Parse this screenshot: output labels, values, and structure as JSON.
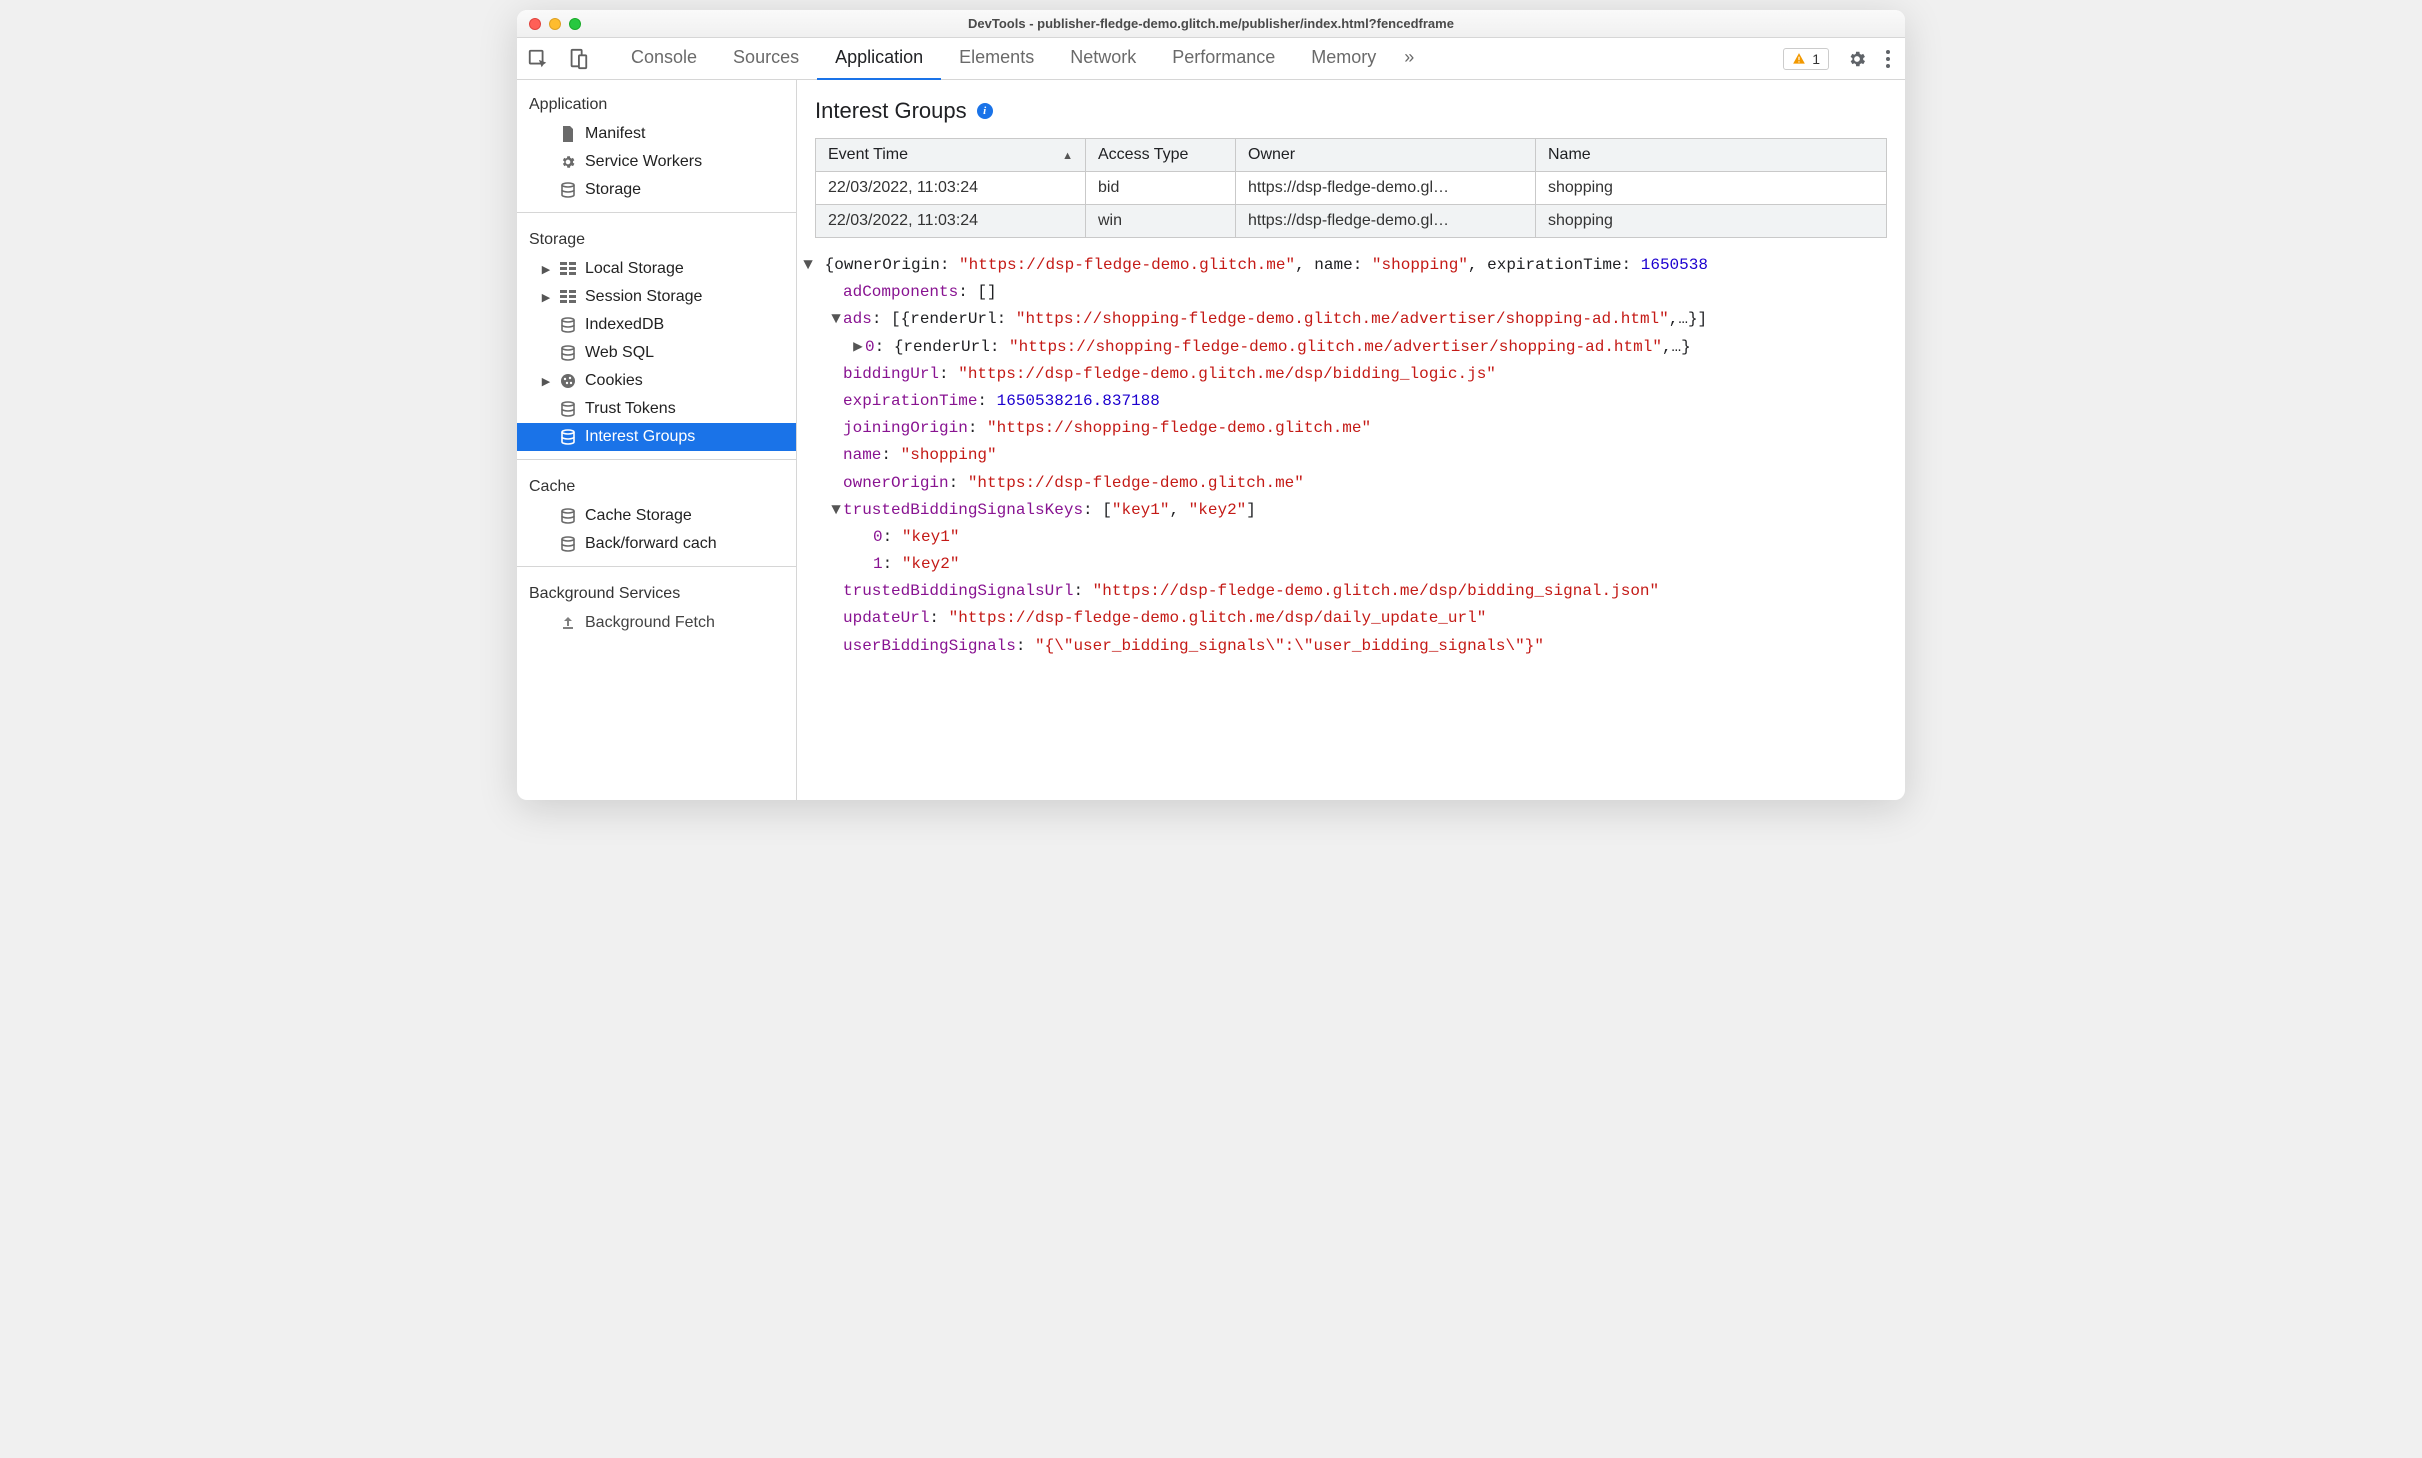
{
  "window": {
    "title": "DevTools - publisher-fledge-demo.glitch.me/publisher/index.html?fencedframe"
  },
  "toolbar": {
    "tabs": [
      "Console",
      "Sources",
      "Application",
      "Elements",
      "Network",
      "Performance",
      "Memory"
    ],
    "active_tab": "Application",
    "overflow_glyph": "»",
    "warning_count": "1"
  },
  "sidebar": {
    "groups": [
      {
        "title": "Application",
        "items": [
          {
            "label": "Manifest",
            "icon": "file-icon",
            "caret": "none"
          },
          {
            "label": "Service Workers",
            "icon": "gear-icon",
            "caret": "none"
          },
          {
            "label": "Storage",
            "icon": "db-icon",
            "caret": "none"
          }
        ]
      },
      {
        "title": "Storage",
        "items": [
          {
            "label": "Local Storage",
            "icon": "grid-icon",
            "caret": "closed"
          },
          {
            "label": "Session Storage",
            "icon": "grid-icon",
            "caret": "closed"
          },
          {
            "label": "IndexedDB",
            "icon": "db-icon",
            "caret": "none"
          },
          {
            "label": "Web SQL",
            "icon": "db-icon",
            "caret": "none"
          },
          {
            "label": "Cookies",
            "icon": "cookie-icon",
            "caret": "closed"
          },
          {
            "label": "Trust Tokens",
            "icon": "db-icon",
            "caret": "none"
          },
          {
            "label": "Interest Groups",
            "icon": "db-icon",
            "caret": "none",
            "active": true
          }
        ]
      },
      {
        "title": "Cache",
        "items": [
          {
            "label": "Cache Storage",
            "icon": "db-icon",
            "caret": "none"
          },
          {
            "label": "Back/forward cach",
            "icon": "db-icon",
            "caret": "none"
          }
        ]
      },
      {
        "title": "Background Services",
        "items": [
          {
            "label": "Background Fetch",
            "icon": "upload-icon",
            "caret": "none"
          }
        ]
      }
    ]
  },
  "panel": {
    "title": "Interest Groups",
    "table": {
      "columns": [
        "Event Time",
        "Access Type",
        "Owner",
        "Name"
      ],
      "sort_column": 0,
      "rows": [
        {
          "time": "22/03/2022, 11:03:24",
          "type": "bid",
          "owner": "https://dsp-fledge-demo.gl…",
          "name": "shopping"
        },
        {
          "time": "22/03/2022, 11:03:24",
          "type": "win",
          "owner": "https://dsp-fledge-demo.gl…",
          "name": "shopping"
        }
      ]
    },
    "detail": {
      "header_prefix": "{ownerOrigin: ",
      "header_owner": "\"https://dsp-fledge-demo.glitch.me\"",
      "header_mid1": ", name: ",
      "header_name": "\"shopping\"",
      "header_mid2": ", expirationTime: ",
      "header_exp": "1650538",
      "adComponents_key": "adComponents",
      "adComponents_val": "[]",
      "ads_key": "ads",
      "ads_summary_pre": "[{renderUrl: ",
      "ads_summary_url": "\"https://shopping-fledge-demo.glitch.me/advertiser/shopping-ad.html\"",
      "ads_summary_post": ",…}]",
      "ads0_key": "0",
      "ads0_pre": "{renderUrl: ",
      "ads0_url": "\"https://shopping-fledge-demo.glitch.me/advertiser/shopping-ad.html\"",
      "ads0_post": ",…}",
      "biddingUrl_key": "biddingUrl",
      "biddingUrl_val": "\"https://dsp-fledge-demo.glitch.me/dsp/bidding_logic.js\"",
      "expirationTime_key": "expirationTime",
      "expirationTime_val": "1650538216.837188",
      "joiningOrigin_key": "joiningOrigin",
      "joiningOrigin_val": "\"https://shopping-fledge-demo.glitch.me\"",
      "name_key": "name",
      "name_val": "\"shopping\"",
      "ownerOrigin_key": "ownerOrigin",
      "ownerOrigin_val": "\"https://dsp-fledge-demo.glitch.me\"",
      "tbsKeys_key": "trustedBiddingSignalsKeys",
      "tbsKeys_val_pre": "[",
      "tbsKeys_val_items0": "\"key1\"",
      "tbsKeys_val_sep": ", ",
      "tbsKeys_val_items1": "\"key2\"",
      "tbsKeys_val_post": "]",
      "tbs0_key": "0",
      "tbs0_val": "\"key1\"",
      "tbs1_key": "1",
      "tbs1_val": "\"key2\"",
      "tbsUrl_key": "trustedBiddingSignalsUrl",
      "tbsUrl_val": "\"https://dsp-fledge-demo.glitch.me/dsp/bidding_signal.json\"",
      "updateUrl_key": "updateUrl",
      "updateUrl_val": "\"https://dsp-fledge-demo.glitch.me/dsp/daily_update_url\"",
      "userBiddingSignals_key": "userBiddingSignals",
      "userBiddingSignals_val": "\"{\\\"user_bidding_signals\\\":\\\"user_bidding_signals\\\"}\""
    }
  }
}
